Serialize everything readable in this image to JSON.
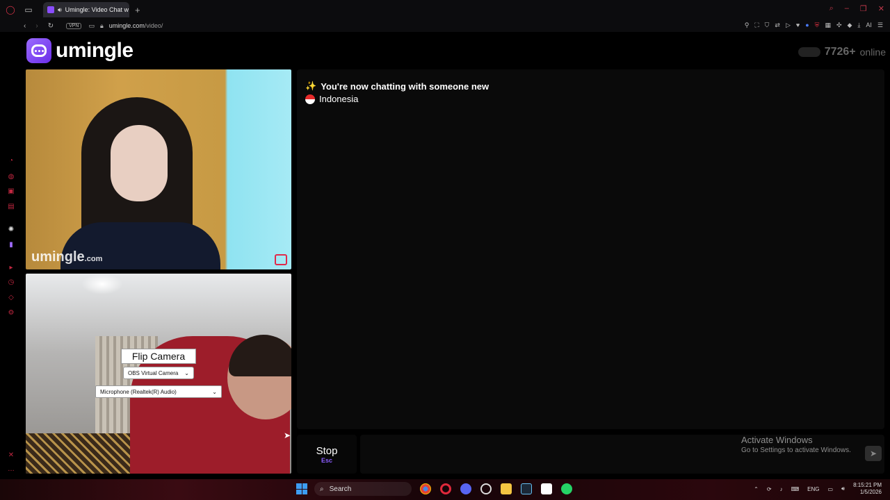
{
  "browser": {
    "tab_title": "Umingle: Video Chat w",
    "new_tab": "+",
    "vpn_label": "VPN",
    "url_host": "umingle.com",
    "url_path": "/video/",
    "ai_label": "AI"
  },
  "site": {
    "logo_text": "umingle",
    "online_count": "7726+",
    "online_word": "online"
  },
  "stranger_video": {
    "watermark": "umingle",
    "watermark_suffix": ".com"
  },
  "self_video": {
    "flip_label": "Flip Camera",
    "camera_select_value": "OBS Virtual Camera",
    "mic_select_value": "Microphone (Realtek(R) Audio)"
  },
  "chat": {
    "status_message": "You're now chatting with someone new",
    "country": "Indonesia"
  },
  "controls": {
    "stop_label": "Stop",
    "stop_shortcut": "Esc"
  },
  "windows_notice": {
    "line1": "Activate Windows",
    "line2": "Go to Settings to activate Windows."
  },
  "taskbar": {
    "search_label": "Search",
    "lang": "ENG",
    "time": "8:15:21 PM",
    "date": "1/5/2026"
  },
  "colors": {
    "accent": "#8c5cff",
    "brand_red": "#d23246",
    "logo_gradient_start": "#9b6bff",
    "logo_gradient_end": "#6b2ee8"
  }
}
